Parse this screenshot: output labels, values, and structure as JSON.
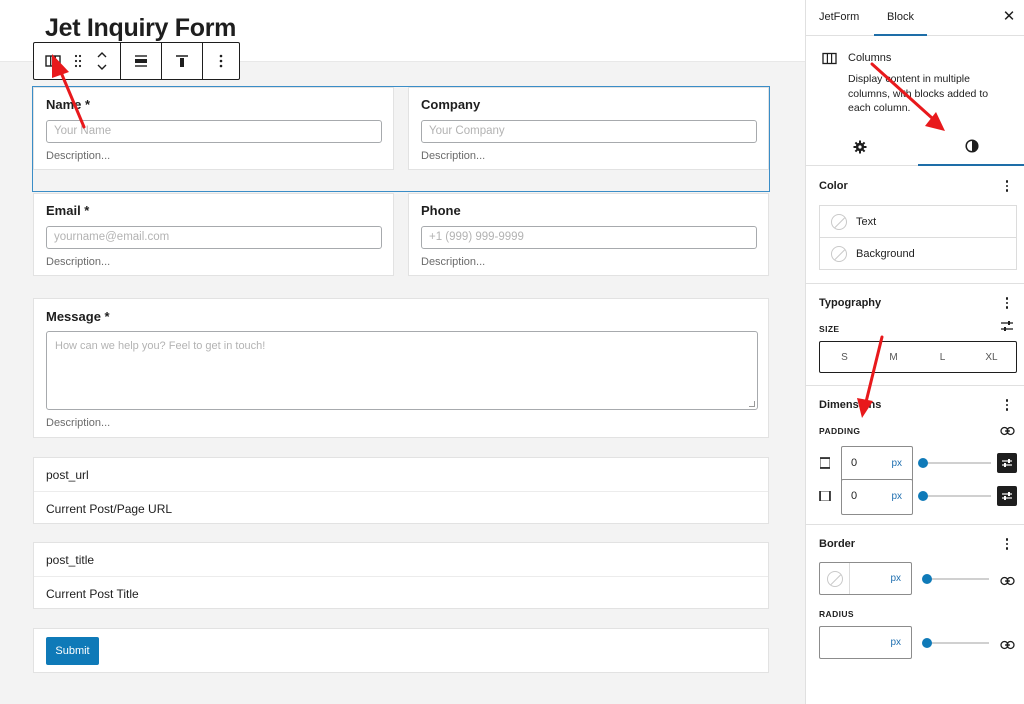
{
  "page": {
    "title": "Jet Inquiry Form"
  },
  "toolbar": {
    "buttons": [
      "columns-icon",
      "drag-handle-icon",
      "move-up-down-icon",
      "align-icon",
      "vertical-align-top-icon",
      "more-options-icon"
    ]
  },
  "form": {
    "name": {
      "label": "Name *",
      "placeholder": "Your Name",
      "description": "Description..."
    },
    "company": {
      "label": "Company",
      "placeholder": "Your Company",
      "description": "Description..."
    },
    "email": {
      "label": "Email *",
      "placeholder": "yourname@email.com",
      "description": "Description..."
    },
    "phone": {
      "label": "Phone",
      "placeholder": "+1 (999) 999-9999",
      "description": "Description..."
    },
    "message": {
      "label": "Message *",
      "placeholder": "How can we help you? Feel to get in touch!",
      "description": "Description..."
    },
    "post_url": {
      "name": "post_url",
      "label": "Current Post/Page URL"
    },
    "post_title": {
      "name": "post_title",
      "label": "Current Post Title"
    },
    "submit": {
      "label": "Submit"
    }
  },
  "sidebar": {
    "tabs": [
      "JetForm",
      "Block"
    ],
    "active_tab": "Block",
    "block": {
      "name": "Columns",
      "description": "Display content in multiple columns, with blocks added to each column."
    },
    "sub_tabs": [
      "settings-gear-icon",
      "styles-contrast-icon"
    ],
    "color": {
      "title": "Color",
      "items": [
        "Text",
        "Background"
      ]
    },
    "typography": {
      "title": "Typography",
      "size_label": "SIZE",
      "sizes": [
        "S",
        "M",
        "L",
        "XL"
      ]
    },
    "dimensions": {
      "title": "Dimensions",
      "padding_label": "PADDING",
      "vertical": {
        "value": "0",
        "unit": "px"
      },
      "horizontal": {
        "value": "0",
        "unit": "px"
      }
    },
    "border": {
      "title": "Border",
      "width_unit": "px",
      "radius_label": "RADIUS",
      "radius_unit": "px"
    }
  },
  "colors": {
    "accent": "#0f7ab8",
    "selection": "#3a8dc7",
    "annotation_arrow": "#e8191c"
  }
}
